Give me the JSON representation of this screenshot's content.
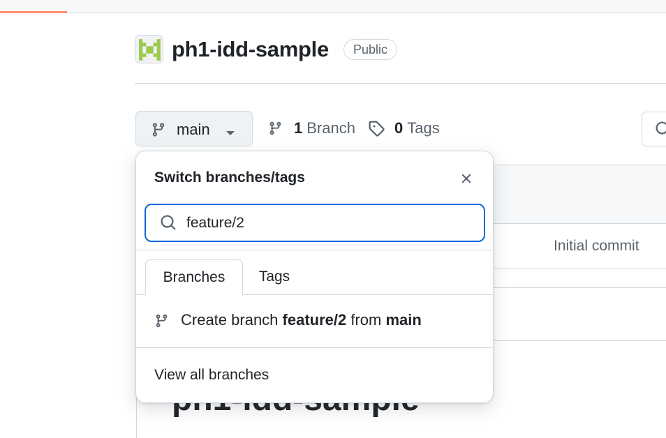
{
  "repo": {
    "name": "ph1-idd-sample",
    "visibility": "Public"
  },
  "branch_selector": {
    "current": "main"
  },
  "counts": {
    "branches_count": "1",
    "branches_label": "Branch",
    "tags_count": "0",
    "tags_label": "Tags"
  },
  "background": {
    "commit_message": "Initial commit",
    "readme_title": "ph1-idd-sample"
  },
  "dropdown": {
    "title": "Switch branches/tags",
    "search_value": "feature/2",
    "tabs": [
      {
        "label": "Branches",
        "selected": true
      },
      {
        "label": "Tags",
        "selected": false
      }
    ],
    "create": {
      "prefix": "Create branch ",
      "new_branch": "feature/2",
      "middle": " from ",
      "source_branch": "main"
    },
    "view_all": "View all branches"
  },
  "colors": {
    "accent": "#0969da",
    "text": "#1f2328",
    "muted": "#59636e",
    "border": "#d1d9e0",
    "progress": "#fd8c73",
    "avatar": "#9bc94a"
  }
}
